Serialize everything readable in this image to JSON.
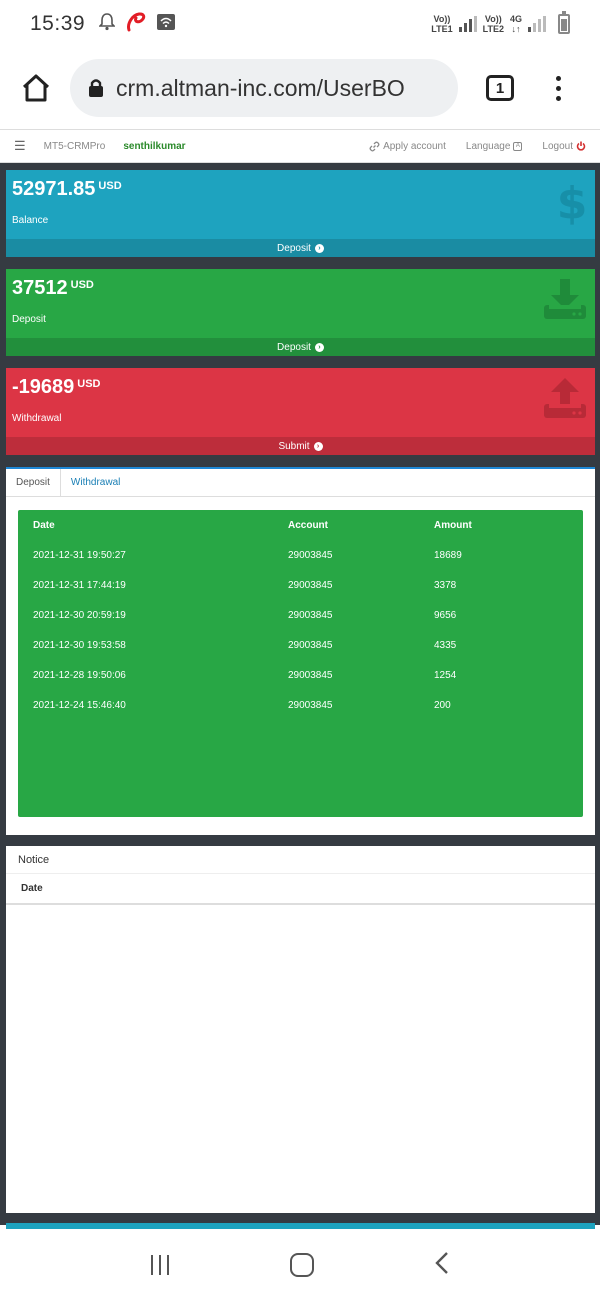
{
  "status_bar": {
    "time": "15:39",
    "net1_line1": "Vo))",
    "net1_line2": "LTE1",
    "net2_line1": "Vo))",
    "net2_line2": "LTE2",
    "net3_line1": "4G",
    "net3_line2": "↓↑"
  },
  "browser": {
    "url": "crm.altman-inc.com/UserBO",
    "tab_count": "1"
  },
  "nav": {
    "brand": "MT5-CRMPro",
    "username": "senthilkumar",
    "apply_account": "Apply account",
    "language": "Language",
    "logout": "Logout"
  },
  "cards": {
    "balance": {
      "amount": "52971.85",
      "currency": "USD",
      "label": "Balance",
      "action": "Deposit"
    },
    "deposit": {
      "amount": "37512",
      "currency": "USD",
      "label": "Deposit",
      "action": "Deposit"
    },
    "withdrawal": {
      "amount": "-19689",
      "currency": "USD",
      "label": "Withdrawal",
      "action": "Submit"
    }
  },
  "transactions": {
    "tabs": [
      "Deposit",
      "Withdrawal"
    ],
    "columns": [
      "Date",
      "Account",
      "Amount"
    ],
    "rows": [
      [
        "2021-12-31 19:50:27",
        "29003845",
        "18689"
      ],
      [
        "2021-12-31 17:44:19",
        "29003845",
        "3378"
      ],
      [
        "2021-12-30 20:59:19",
        "29003845",
        "9656"
      ],
      [
        "2021-12-30 19:53:58",
        "29003845",
        "4335"
      ],
      [
        "2021-12-28 19:50:06",
        "29003845",
        "1254"
      ],
      [
        "2021-12-24 15:46:40",
        "29003845",
        "200"
      ]
    ]
  },
  "notice": {
    "title": "Notice",
    "column": "Date"
  },
  "colors": {
    "balance": "#1ea3bf",
    "deposit": "#28a745",
    "withdrawal": "#dc3545",
    "page_bg": "#353b42"
  }
}
